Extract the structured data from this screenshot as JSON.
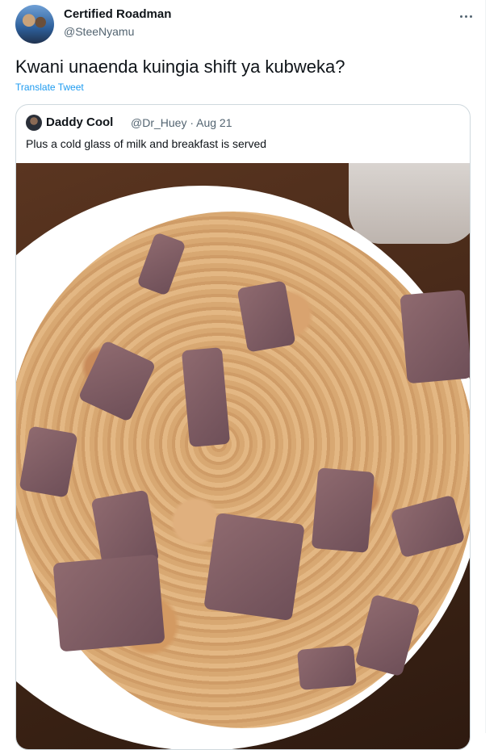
{
  "tweet": {
    "author_name": "Certified Roadman",
    "author_handle": "@SteeNyamu",
    "text": "Kwani unaenda kuingia shift ya kubweka?",
    "translate_label": "Translate Tweet",
    "more_icon": "more-options-icon"
  },
  "quoted_tweet": {
    "author_name": "Daddy Cool",
    "author_handle_date": "@Dr_Huey · Aug 21",
    "text": "Plus a cold glass of milk and breakfast is served",
    "image_description": "breakfast-plate-photo"
  },
  "colors": {
    "text_primary": "#0f1419",
    "text_secondary": "#536471",
    "link": "#1d9bf0",
    "border": "#cfd9de"
  }
}
